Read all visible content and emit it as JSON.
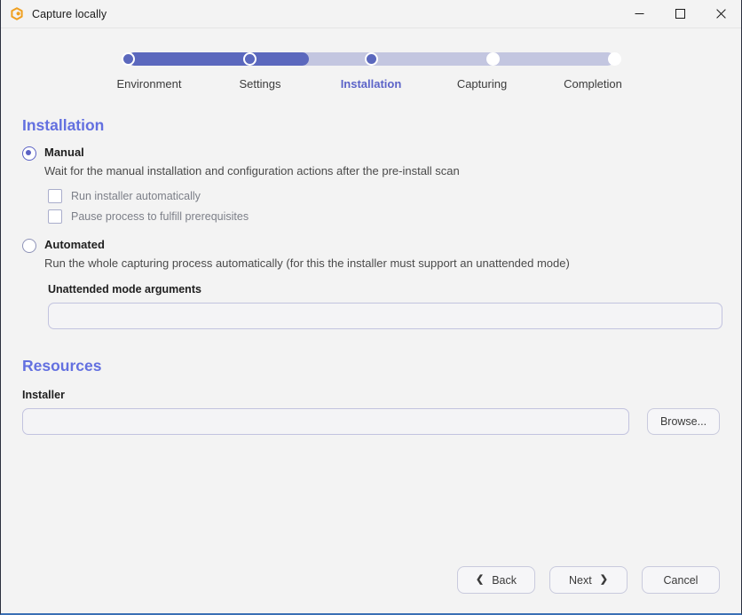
{
  "window": {
    "title": "Capture locally",
    "icon": "app-logo-icon",
    "controls": {
      "minimize": "─",
      "maximize": "□",
      "close": "✕"
    }
  },
  "stepper": {
    "current_index": 2,
    "active_color": "#5b68bd",
    "inactive_color": "#c3c6e0",
    "active_label_color": "#5c64c8",
    "steps": [
      {
        "label": "Environment",
        "state": "done"
      },
      {
        "label": "Settings",
        "state": "done"
      },
      {
        "label": "Installation",
        "state": "current"
      },
      {
        "label": "Capturing",
        "state": "upcoming"
      },
      {
        "label": "Completion",
        "state": "upcoming"
      }
    ]
  },
  "installation": {
    "heading": "Installation",
    "heading_color": "#6370e0",
    "options": [
      {
        "id": "manual",
        "title": "Manual",
        "description": "Wait for the manual installation and configuration actions after the pre-install scan",
        "selected": true
      },
      {
        "id": "automated",
        "title": "Automated",
        "description": "Run the whole capturing process automatically (for this the installer must support an unattended mode)",
        "selected": false
      }
    ],
    "checkboxes": [
      {
        "id": "run-installer-automatically",
        "label": "Run installer automatically",
        "checked": false
      },
      {
        "id": "pause-process-prerequisites",
        "label": "Pause process to fulfill prerequisites",
        "checked": false
      }
    ],
    "unattended": {
      "label": "Unattended mode arguments",
      "value": "",
      "placeholder": ""
    }
  },
  "resources": {
    "heading": "Resources",
    "installer": {
      "label": "Installer",
      "value": "",
      "placeholder": "",
      "browse_label": "Browse..."
    }
  },
  "footer": {
    "back_label": "Back",
    "back_icon": "chevron-left-icon",
    "back_glyph": "❮",
    "next_label": "Next",
    "next_icon": "chevron-right-icon",
    "next_glyph": "❯",
    "cancel_label": "Cancel"
  }
}
